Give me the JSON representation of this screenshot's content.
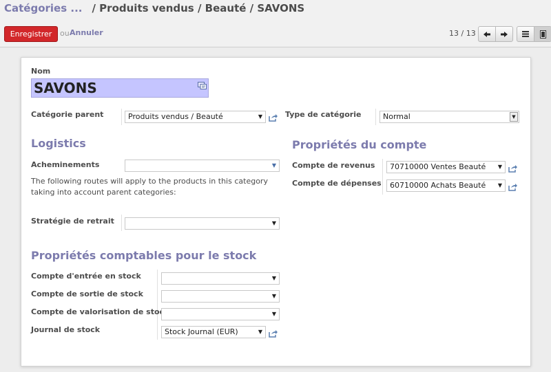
{
  "breadcrumb": {
    "parent": "Catégories ...",
    "current": "/ Produits vendus / Beauté / SAVONS"
  },
  "actions": {
    "save": "Enregistrer",
    "or": "ou",
    "cancel": "Annuler"
  },
  "pager": {
    "text": "13 / 13"
  },
  "form": {
    "name_label": "Nom",
    "name_value": "SAVONS",
    "parent_label": "Catégorie parent",
    "parent_value": "Produits vendus / Beauté",
    "type_label": "Type de catégorie",
    "type_value": "Normal",
    "logistics_title": "Logistics",
    "routes_label": "Acheminements",
    "routes_value": "",
    "routes_help": "The following routes will apply to the products in this category taking into account parent categories:",
    "removal_label": "Stratégie de retrait",
    "removal_value": "",
    "account_props_title": "Propriétés du compte",
    "income_label": "Compte de revenus",
    "income_value": "70710000 Ventes Beauté",
    "expense_label": "Compte de dépenses",
    "expense_value": "60710000 Achats Beauté",
    "stock_title": "Propriétés comptables pour le stock",
    "stock_in_label": "Compte d'entrée en stock",
    "stock_in_value": "",
    "stock_out_label": "Compte de sortie de stock",
    "stock_out_value": "",
    "stock_val_label": "Compte de valorisation de stock",
    "stock_val_value": "",
    "journal_label": "Journal de stock",
    "journal_value": "Stock Journal (EUR)"
  },
  "colors": {
    "accent": "#7c7bad",
    "primary": "#d2272a",
    "highlight": "#c5c5ff"
  }
}
